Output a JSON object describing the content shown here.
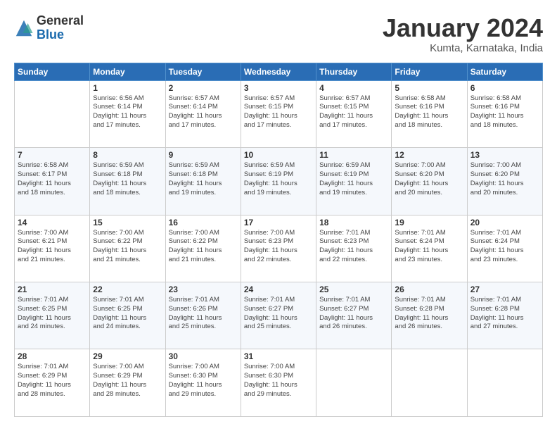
{
  "logo": {
    "general": "General",
    "blue": "Blue"
  },
  "title": {
    "month": "January 2024",
    "location": "Kumta, Karnataka, India"
  },
  "weekdays": [
    "Sunday",
    "Monday",
    "Tuesday",
    "Wednesday",
    "Thursday",
    "Friday",
    "Saturday"
  ],
  "weeks": [
    [
      {
        "day": "",
        "info": ""
      },
      {
        "day": "1",
        "info": "Sunrise: 6:56 AM\nSunset: 6:14 PM\nDaylight: 11 hours\nand 17 minutes."
      },
      {
        "day": "2",
        "info": "Sunrise: 6:57 AM\nSunset: 6:14 PM\nDaylight: 11 hours\nand 17 minutes."
      },
      {
        "day": "3",
        "info": "Sunrise: 6:57 AM\nSunset: 6:15 PM\nDaylight: 11 hours\nand 17 minutes."
      },
      {
        "day": "4",
        "info": "Sunrise: 6:57 AM\nSunset: 6:15 PM\nDaylight: 11 hours\nand 17 minutes."
      },
      {
        "day": "5",
        "info": "Sunrise: 6:58 AM\nSunset: 6:16 PM\nDaylight: 11 hours\nand 18 minutes."
      },
      {
        "day": "6",
        "info": "Sunrise: 6:58 AM\nSunset: 6:16 PM\nDaylight: 11 hours\nand 18 minutes."
      }
    ],
    [
      {
        "day": "7",
        "info": "Sunrise: 6:58 AM\nSunset: 6:17 PM\nDaylight: 11 hours\nand 18 minutes."
      },
      {
        "day": "8",
        "info": "Sunrise: 6:59 AM\nSunset: 6:18 PM\nDaylight: 11 hours\nand 18 minutes."
      },
      {
        "day": "9",
        "info": "Sunrise: 6:59 AM\nSunset: 6:18 PM\nDaylight: 11 hours\nand 19 minutes."
      },
      {
        "day": "10",
        "info": "Sunrise: 6:59 AM\nSunset: 6:19 PM\nDaylight: 11 hours\nand 19 minutes."
      },
      {
        "day": "11",
        "info": "Sunrise: 6:59 AM\nSunset: 6:19 PM\nDaylight: 11 hours\nand 19 minutes."
      },
      {
        "day": "12",
        "info": "Sunrise: 7:00 AM\nSunset: 6:20 PM\nDaylight: 11 hours\nand 20 minutes."
      },
      {
        "day": "13",
        "info": "Sunrise: 7:00 AM\nSunset: 6:20 PM\nDaylight: 11 hours\nand 20 minutes."
      }
    ],
    [
      {
        "day": "14",
        "info": "Sunrise: 7:00 AM\nSunset: 6:21 PM\nDaylight: 11 hours\nand 21 minutes."
      },
      {
        "day": "15",
        "info": "Sunrise: 7:00 AM\nSunset: 6:22 PM\nDaylight: 11 hours\nand 21 minutes."
      },
      {
        "day": "16",
        "info": "Sunrise: 7:00 AM\nSunset: 6:22 PM\nDaylight: 11 hours\nand 21 minutes."
      },
      {
        "day": "17",
        "info": "Sunrise: 7:00 AM\nSunset: 6:23 PM\nDaylight: 11 hours\nand 22 minutes."
      },
      {
        "day": "18",
        "info": "Sunrise: 7:01 AM\nSunset: 6:23 PM\nDaylight: 11 hours\nand 22 minutes."
      },
      {
        "day": "19",
        "info": "Sunrise: 7:01 AM\nSunset: 6:24 PM\nDaylight: 11 hours\nand 23 minutes."
      },
      {
        "day": "20",
        "info": "Sunrise: 7:01 AM\nSunset: 6:24 PM\nDaylight: 11 hours\nand 23 minutes."
      }
    ],
    [
      {
        "day": "21",
        "info": "Sunrise: 7:01 AM\nSunset: 6:25 PM\nDaylight: 11 hours\nand 24 minutes."
      },
      {
        "day": "22",
        "info": "Sunrise: 7:01 AM\nSunset: 6:25 PM\nDaylight: 11 hours\nand 24 minutes."
      },
      {
        "day": "23",
        "info": "Sunrise: 7:01 AM\nSunset: 6:26 PM\nDaylight: 11 hours\nand 25 minutes."
      },
      {
        "day": "24",
        "info": "Sunrise: 7:01 AM\nSunset: 6:27 PM\nDaylight: 11 hours\nand 25 minutes."
      },
      {
        "day": "25",
        "info": "Sunrise: 7:01 AM\nSunset: 6:27 PM\nDaylight: 11 hours\nand 26 minutes."
      },
      {
        "day": "26",
        "info": "Sunrise: 7:01 AM\nSunset: 6:28 PM\nDaylight: 11 hours\nand 26 minutes."
      },
      {
        "day": "27",
        "info": "Sunrise: 7:01 AM\nSunset: 6:28 PM\nDaylight: 11 hours\nand 27 minutes."
      }
    ],
    [
      {
        "day": "28",
        "info": "Sunrise: 7:01 AM\nSunset: 6:29 PM\nDaylight: 11 hours\nand 28 minutes."
      },
      {
        "day": "29",
        "info": "Sunrise: 7:00 AM\nSunset: 6:29 PM\nDaylight: 11 hours\nand 28 minutes."
      },
      {
        "day": "30",
        "info": "Sunrise: 7:00 AM\nSunset: 6:30 PM\nDaylight: 11 hours\nand 29 minutes."
      },
      {
        "day": "31",
        "info": "Sunrise: 7:00 AM\nSunset: 6:30 PM\nDaylight: 11 hours\nand 29 minutes."
      },
      {
        "day": "",
        "info": ""
      },
      {
        "day": "",
        "info": ""
      },
      {
        "day": "",
        "info": ""
      }
    ]
  ]
}
